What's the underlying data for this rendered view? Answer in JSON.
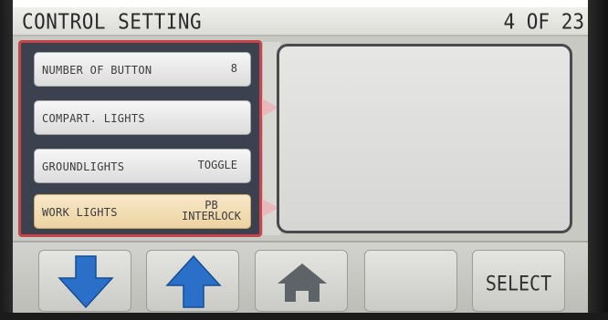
{
  "header": {
    "title": "CONTROL SETTING",
    "page_indicator": "4 OF 23"
  },
  "menu": {
    "items": [
      {
        "label": "NUMBER OF BUTTON",
        "value": "8",
        "selected": false
      },
      {
        "label": "COMPART. LIGHTS",
        "value": "",
        "selected": false
      },
      {
        "label": "GROUNDLIGHTS",
        "value": "TOGGLE",
        "selected": false
      },
      {
        "label": "WORK LIGHTS",
        "value_line1": "PB",
        "value_line2": "INTERLOCK",
        "selected": true
      }
    ]
  },
  "detail": {},
  "nav": {
    "down_icon": "arrow-down-icon",
    "up_icon": "arrow-up-icon",
    "home_icon": "home-icon",
    "blank": "",
    "select_label": "SELECT"
  },
  "colors": {
    "selection_border": "#c9434a",
    "panel_bg": "#3c4150",
    "arrow_blue": "#2a6fc8",
    "selected_item": "#ecd3a1"
  }
}
